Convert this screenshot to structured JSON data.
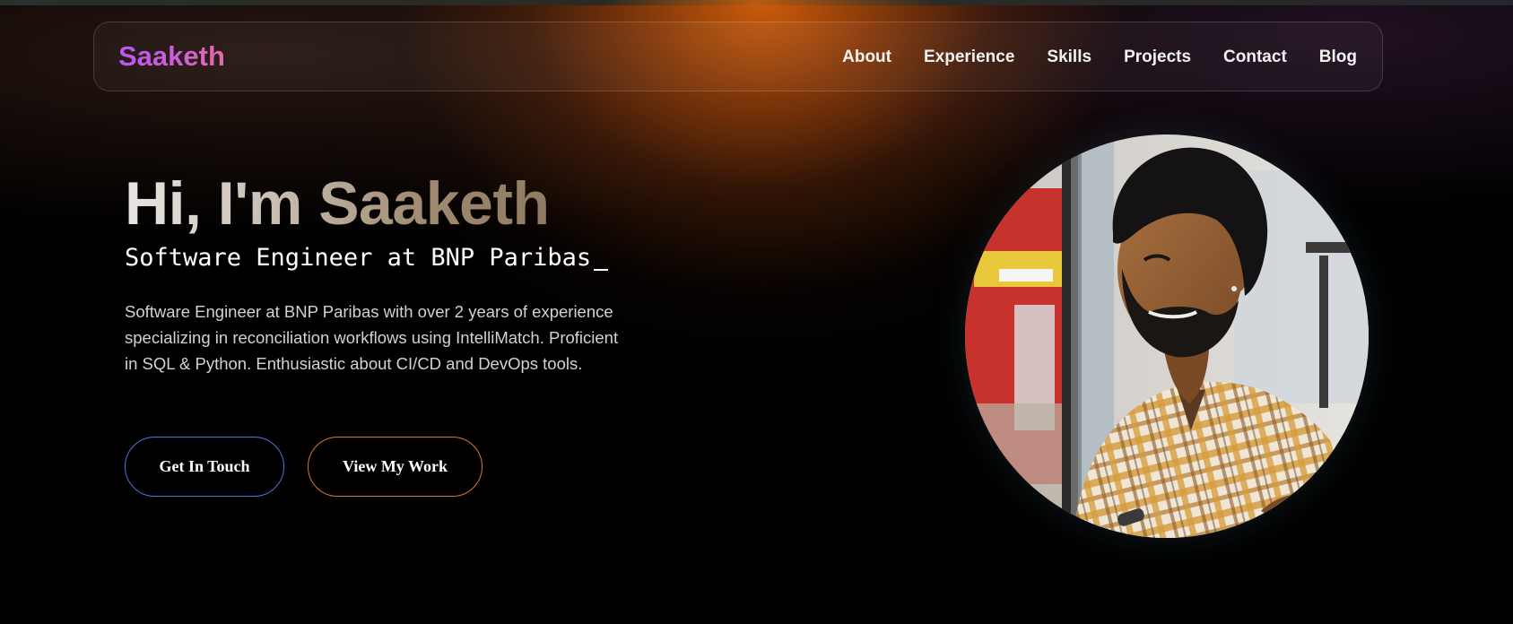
{
  "nav": {
    "logo": "Saaketh",
    "links": [
      "About",
      "Experience",
      "Skills",
      "Projects",
      "Contact",
      "Blog"
    ]
  },
  "hero": {
    "title": "Hi, I'm Saaketh",
    "subtitle": "Software Engineer at BNP Paribas",
    "description": "Software Engineer at BNP Paribas with over 2 years of experience specializing in reconciliation workflows using IntelliMatch. Proficient in SQL & Python. Enthusiastic about CI/CD and DevOps tools.",
    "buttons": {
      "contact": "Get In Touch",
      "work": "View My Work"
    }
  },
  "profile": {
    "image": "profile-photo"
  },
  "colors": {
    "logo_gradient_start": "#b557f2",
    "logo_gradient_end": "#e46aa8",
    "glow": "#d6600c",
    "button_contact_border": "#4f73d9",
    "button_work_border": "#d9772b",
    "background": "#000000"
  }
}
